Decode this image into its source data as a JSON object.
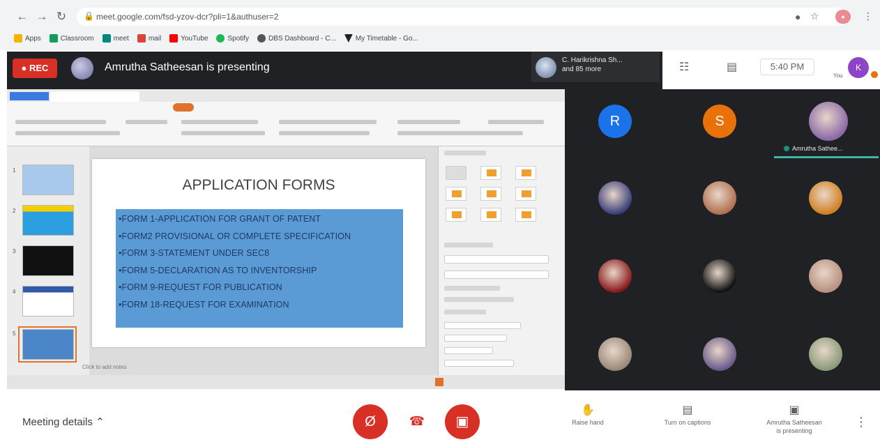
{
  "browser": {
    "url": "meet.google.com/fsd-yzov-dcr?pli=1&authuser=2",
    "bookmarks": [
      "Apps",
      "Classroom",
      "meet",
      "mail",
      "YouTube",
      "Spotify",
      "DBS Dashboard - C...",
      "My Timetable - Go..."
    ]
  },
  "meet": {
    "rec_label": "REC",
    "presenting_title": "Amrutha Satheesan is presenting",
    "participants_chip": {
      "line1": "C. Harikrishna Sh...",
      "line2": "and 85 more"
    },
    "time": "5:40 PM",
    "you_label": "You",
    "self_initial": "K"
  },
  "slide": {
    "title": "APPLICATION FORMS",
    "bullets": [
      "•FORM 1-APPLICATION FOR GRANT OF PATENT",
      "•FORM2 PROVISIONAL OR COMPLETE SPECIFICATION",
      "•FORM 3-STATEMENT UNDER SEC8",
      "•FORM 5-DECLARATION AS TO INVENTORSHIP",
      "•FORM 9-REQUEST FOR PUBLICATION",
      "•FORM 18-REQUEST FOR EXAMINATION"
    ],
    "click_to_add_notes": "Click to add notes",
    "slide_numbers": [
      "1",
      "2",
      "3",
      "4",
      "5"
    ]
  },
  "grid": {
    "tiles": [
      {
        "initial": "R",
        "color": "#1a73e8"
      },
      {
        "initial": "S",
        "color": "#e8710a"
      },
      {
        "initial": "",
        "color": "#8a6aa8"
      },
      {
        "initial": "",
        "color": "#3b3f7a"
      },
      {
        "initial": "",
        "color": "#b07050"
      },
      {
        "initial": "",
        "color": "#d08020"
      },
      {
        "initial": "",
        "color": "#8a1a1a"
      },
      {
        "initial": "",
        "color": "#111111"
      },
      {
        "initial": "",
        "color": "#b89080"
      },
      {
        "initial": "",
        "color": "#9a8878"
      },
      {
        "initial": "",
        "color": "#6a5a8a"
      },
      {
        "initial": "",
        "color": "#8a9a78"
      }
    ],
    "self_name": "Amrutha Sathee..."
  },
  "bottom": {
    "meeting_details": "Meeting details",
    "raise_hand": "Raise hand",
    "captions": "Turn on captions",
    "presenting_line1": "Amrutha Satheesan",
    "presenting_line2": "is presenting"
  },
  "colors": {
    "rec": "#d93025",
    "dark": "#202124",
    "slide_box": "#5b9bd5",
    "accent_orange": "#e0722b"
  },
  "icons": [
    "back-icon",
    "forward-icon",
    "reload-icon",
    "lock-icon",
    "mic-off-icon",
    "leave-call-icon",
    "camera-off-icon",
    "hand-icon",
    "captions-icon",
    "present-icon",
    "chat-icon",
    "people-icon",
    "more-vert-icon"
  ]
}
